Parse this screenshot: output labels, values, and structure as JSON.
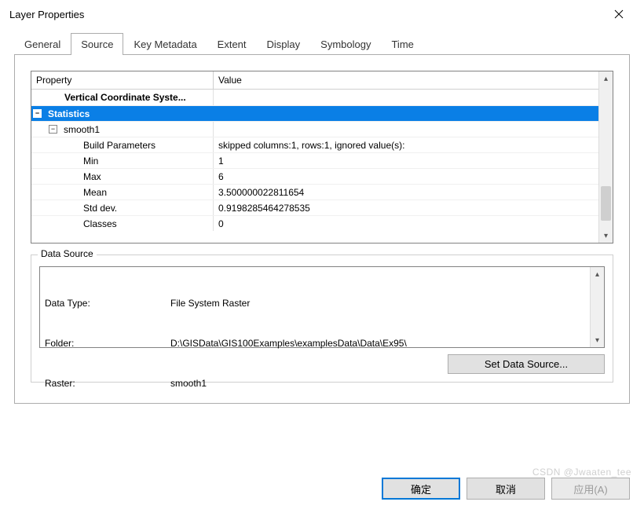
{
  "window": {
    "title": "Layer Properties"
  },
  "tabs": [
    {
      "id": "general",
      "label": "General"
    },
    {
      "id": "source",
      "label": "Source"
    },
    {
      "id": "keymeta",
      "label": "Key Metadata"
    },
    {
      "id": "extent",
      "label": "Extent"
    },
    {
      "id": "display",
      "label": "Display"
    },
    {
      "id": "symbology",
      "label": "Symbology"
    },
    {
      "id": "time",
      "label": "Time"
    }
  ],
  "selected_tab": "source",
  "property_grid": {
    "headers": {
      "property": "Property",
      "value": "Value"
    },
    "rows": [
      {
        "kind": "group",
        "level": 1,
        "label": "Vertical Coordinate Syste...",
        "bold": true
      },
      {
        "kind": "group",
        "level": 0,
        "label": "Statistics",
        "bold": true,
        "expanded": true,
        "selected": true
      },
      {
        "kind": "group",
        "level": 1,
        "label": "smooth1",
        "expanded": true
      },
      {
        "kind": "leaf",
        "level": 2,
        "label": "Build Parameters",
        "value": "skipped columns:1, rows:1, ignored value(s):"
      },
      {
        "kind": "leaf",
        "level": 2,
        "label": "Min",
        "value": "1"
      },
      {
        "kind": "leaf",
        "level": 2,
        "label": "Max",
        "value": "6"
      },
      {
        "kind": "leaf",
        "level": 2,
        "label": "Mean",
        "value": "3.500000022811654"
      },
      {
        "kind": "leaf",
        "level": 2,
        "label": "Std dev.",
        "value": "0.9198285464278535"
      },
      {
        "kind": "leaf",
        "level": 2,
        "label": "Classes",
        "value": "0"
      }
    ]
  },
  "data_source": {
    "legend": "Data Source",
    "lines": [
      {
        "key": "Data Type:",
        "value": "File System Raster"
      },
      {
        "key": "Folder:",
        "value": "D:\\GISData\\GIS100Examples\\examplesData\\Data\\Ex95\\"
      },
      {
        "key": "Raster:",
        "value": "smooth1"
      }
    ],
    "set_button": "Set Data Source..."
  },
  "footer": {
    "ok": "确定",
    "cancel": "取消",
    "apply": "应用(A)"
  },
  "watermark": "CSDN @Jwaaten_tee"
}
